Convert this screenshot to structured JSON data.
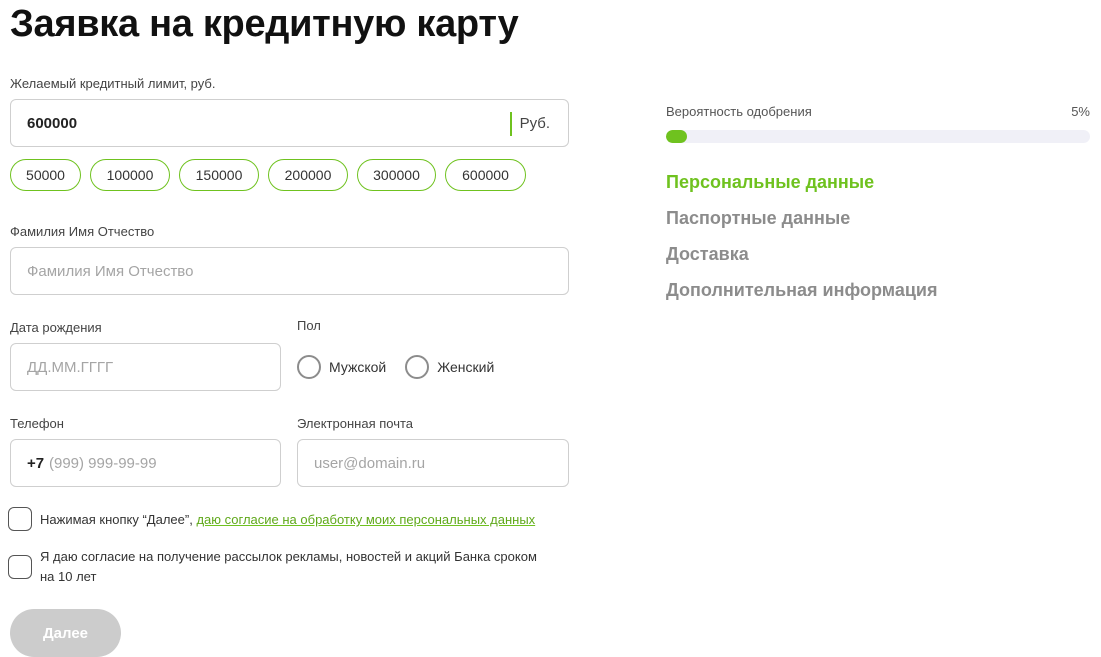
{
  "page": {
    "title": "Заявка на кредитную карту"
  },
  "credit_limit": {
    "label": "Желаемый кредитный лимит, руб.",
    "value": "600000",
    "unit": "Руб.",
    "presets": [
      "50000",
      "100000",
      "150000",
      "200000",
      "300000",
      "600000"
    ]
  },
  "full_name": {
    "label": "Фамилия Имя Отчество",
    "placeholder": "Фамилия Имя Отчество"
  },
  "birth_date": {
    "label": "Дата рождения",
    "placeholder": "ДД.ММ.ГГГГ"
  },
  "gender": {
    "label": "Пол",
    "options": [
      "Мужской",
      "Женский"
    ]
  },
  "phone": {
    "label": "Телефон",
    "prefix": "+7",
    "placeholder": "(999) 999-99-99"
  },
  "email": {
    "label": "Электронная почта",
    "placeholder": "user@domain.ru"
  },
  "consents": {
    "personal_data_text": "Нажимая кнопку “Далее”, ",
    "personal_data_link": "даю согласие на обработку моих персональных данных",
    "marketing_line1": "Я даю согласие на получение рассылок рекламы, новостей и акций Банка сроком",
    "marketing_line2": "на 10 лет"
  },
  "next_button": {
    "label": "Далее"
  },
  "approval": {
    "label": "Вероятность одобрения",
    "value_text": "5%",
    "percent": 5
  },
  "steps": [
    {
      "label": "Персональные данные",
      "active": true
    },
    {
      "label": "Паспортные данные",
      "active": false
    },
    {
      "label": "Доставка",
      "active": false
    },
    {
      "label": "Дополнительная информация",
      "active": false
    }
  ],
  "colors": {
    "accent": "#6fc21f",
    "inactive_step": "#8c8c8c",
    "button_disabled": "#cccccc"
  }
}
